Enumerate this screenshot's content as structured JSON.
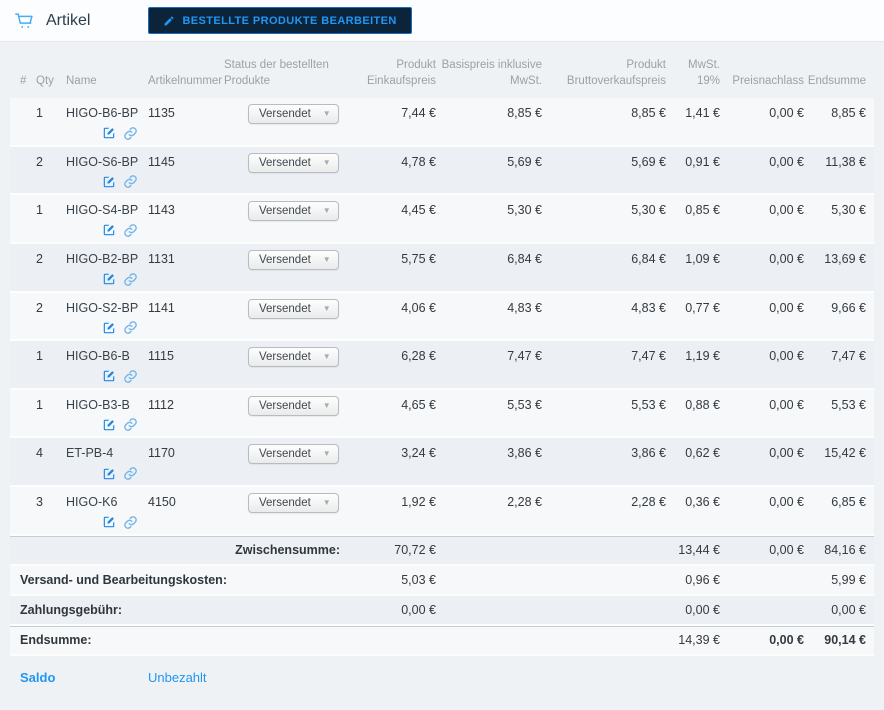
{
  "header": {
    "title": "Artikel",
    "edit_button_label": "BESTELLTE PRODUKTE BEARBEITEN"
  },
  "table": {
    "columns": {
      "hash": "#",
      "qty": "Qty",
      "name": "Name",
      "artikelnummer": "Artikelnummer",
      "status": "Status der bestellten Produkte",
      "einkaufspreis": "Produkt Einkaufspreis",
      "basispreis": "Basispreis inklusive MwSt.",
      "bruttoverkaufspreis": "Produkt Bruttoverkaufspreis",
      "mwst": "MwSt. 19%",
      "preisnachlass": "Preisnachlass",
      "endsumme": "Endsumme"
    },
    "rows": [
      {
        "qty": "1",
        "name": "HIGO-B6-BP",
        "artikelnummer": "1135",
        "status": "Versendet",
        "einkaufspreis": "7,44 €",
        "basispreis": "8,85 €",
        "bruttoverkaufspreis": "8,85 €",
        "mwst": "1,41 €",
        "preisnachlass": "0,00 €",
        "endsumme": "8,85 €"
      },
      {
        "qty": "2",
        "name": "HIGO-S6-BP",
        "artikelnummer": "1145",
        "status": "Versendet",
        "einkaufspreis": "4,78 €",
        "basispreis": "5,69 €",
        "bruttoverkaufspreis": "5,69 €",
        "mwst": "0,91 €",
        "preisnachlass": "0,00 €",
        "endsumme": "11,38 €"
      },
      {
        "qty": "1",
        "name": "HIGO-S4-BP",
        "artikelnummer": "1143",
        "status": "Versendet",
        "einkaufspreis": "4,45 €",
        "basispreis": "5,30 €",
        "bruttoverkaufspreis": "5,30 €",
        "mwst": "0,85 €",
        "preisnachlass": "0,00 €",
        "endsumme": "5,30 €"
      },
      {
        "qty": "2",
        "name": "HIGO-B2-BP",
        "artikelnummer": "1131",
        "status": "Versendet",
        "einkaufspreis": "5,75 €",
        "basispreis": "6,84 €",
        "bruttoverkaufspreis": "6,84 €",
        "mwst": "1,09 €",
        "preisnachlass": "0,00 €",
        "endsumme": "13,69 €"
      },
      {
        "qty": "2",
        "name": "HIGO-S2-BP",
        "artikelnummer": "1141",
        "status": "Versendet",
        "einkaufspreis": "4,06 €",
        "basispreis": "4,83 €",
        "bruttoverkaufspreis": "4,83 €",
        "mwst": "0,77 €",
        "preisnachlass": "0,00 €",
        "endsumme": "9,66 €"
      },
      {
        "qty": "1",
        "name": "HIGO-B6-B",
        "artikelnummer": "1115",
        "status": "Versendet",
        "einkaufspreis": "6,28 €",
        "basispreis": "7,47 €",
        "bruttoverkaufspreis": "7,47 €",
        "mwst": "1,19 €",
        "preisnachlass": "0,00 €",
        "endsumme": "7,47 €"
      },
      {
        "qty": "1",
        "name": "HIGO-B3-B",
        "artikelnummer": "1112",
        "status": "Versendet",
        "einkaufspreis": "4,65 €",
        "basispreis": "5,53 €",
        "bruttoverkaufspreis": "5,53 €",
        "mwst": "0,88 €",
        "preisnachlass": "0,00 €",
        "endsumme": "5,53 €"
      },
      {
        "qty": "4",
        "name": "ET-PB-4",
        "artikelnummer": "1170",
        "status": "Versendet",
        "einkaufspreis": "3,24 €",
        "basispreis": "3,86 €",
        "bruttoverkaufspreis": "3,86 €",
        "mwst": "0,62 €",
        "preisnachlass": "0,00 €",
        "endsumme": "15,42 €"
      },
      {
        "qty": "3",
        "name": "HIGO-K6",
        "artikelnummer": "4150",
        "status": "Versendet",
        "einkaufspreis": "1,92 €",
        "basispreis": "2,28 €",
        "bruttoverkaufspreis": "2,28 €",
        "mwst": "0,36 €",
        "preisnachlass": "0,00 €",
        "endsumme": "6,85 €"
      }
    ],
    "summary": {
      "zwischensumme": {
        "label": "Zwischensumme:",
        "einkaufspreis": "70,72 €",
        "mwst": "13,44 €",
        "preisnachlass": "0,00 €",
        "endsumme": "84,16 €"
      },
      "versand": {
        "label": "Versand- und Bearbeitungskosten:",
        "einkaufspreis": "5,03 €",
        "mwst": "0,96 €",
        "endsumme": "5,99 €"
      },
      "zahlungsgebuehr": {
        "label": "Zahlungsgebühr:",
        "einkaufspreis": "0,00 €",
        "mwst": "0,00 €",
        "endsumme": "0,00 €"
      },
      "endsumme": {
        "label": "Endsumme:",
        "mwst": "14,39 €",
        "preisnachlass": "0,00 €",
        "endsumme": "90,14 €"
      }
    }
  },
  "footer": {
    "saldo_label": "Saldo",
    "saldo_value": "Unbezahlt"
  },
  "colors": {
    "accent_blue": "#2196f3",
    "button_background": "#0c2439",
    "button_border": "#1a6cc2",
    "row_light": "#f6f8f9",
    "row_dark": "#ecf0f4",
    "header_text": "#9aa1a8",
    "cart_icon": "#45aef5"
  }
}
